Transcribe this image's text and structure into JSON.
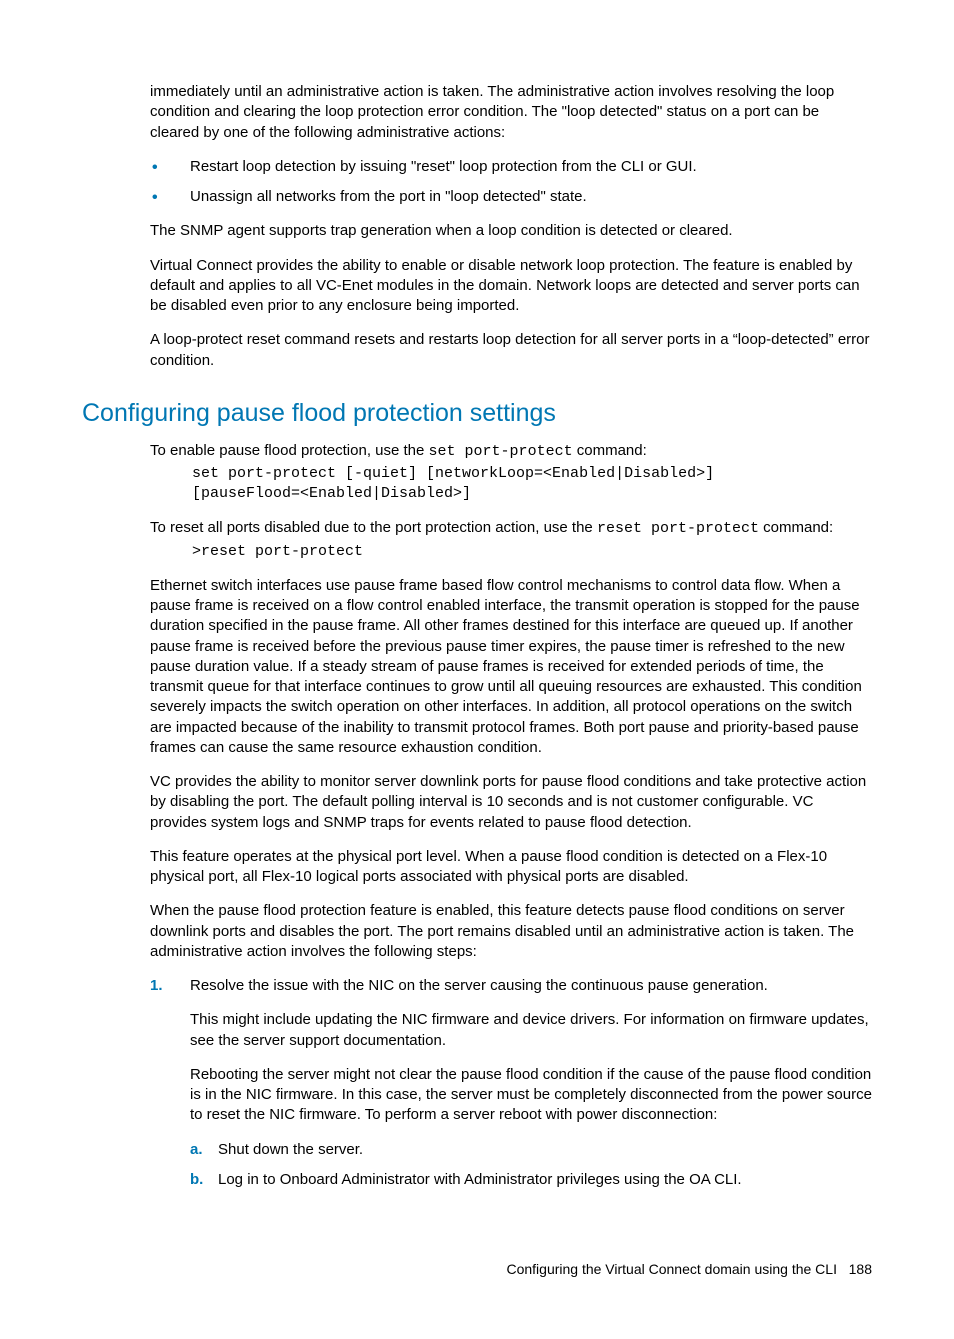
{
  "intro": {
    "p1": "immediately until an administrative action is taken. The administrative action involves resolving the loop condition and clearing the loop protection error condition. The \"loop detected\" status on a port can be cleared by one of the following administrative actions:",
    "bullets": [
      "Restart loop detection by issuing \"reset\" loop protection from the CLI or GUI.",
      "Unassign all networks from the port in \"loop detected\" state."
    ],
    "p2": "The SNMP agent supports trap generation when a loop condition is detected or cleared.",
    "p3": "Virtual Connect provides the ability to enable or disable network loop protection. The feature is enabled by default and applies to all VC-Enet modules in the domain. Network loops are detected and server ports can be disabled even prior to any enclosure being imported.",
    "p4": "A loop-protect reset command resets and restarts loop detection for all server ports in a “loop-detected” error condition."
  },
  "section": {
    "heading": "Configuring pause flood protection settings",
    "p1_a": "To enable pause flood protection, use the ",
    "p1_code": "set port-protect",
    "p1_b": " command:",
    "code1": "set port-protect [-quiet] [networkLoop=<Enabled|Disabled>]\n[pauseFlood=<Enabled|Disabled>]",
    "p2_a": "To reset all ports disabled due to the port protection action, use the ",
    "p2_code": "reset port-protect",
    "p2_b": " command:",
    "code2": ">reset port-protect",
    "p3": "Ethernet switch interfaces use pause frame based flow control mechanisms to control data flow. When a pause frame is received on a flow control enabled interface, the transmit operation is stopped for the pause duration specified in the pause frame. All other frames destined for this interface are queued up. If another pause frame is received before the previous pause timer expires, the pause timer is refreshed to the new pause duration value. If a steady stream of pause frames is received for extended periods of time, the transmit queue for that interface continues to grow until all queuing resources are exhausted. This condition severely impacts the switch operation on other interfaces. In addition, all protocol operations on the switch are impacted because of the inability to transmit protocol frames. Both port pause and priority-based pause frames can cause the same resource exhaustion condition.",
    "p4": "VC provides the ability to monitor server downlink ports for pause flood conditions and take protective action by disabling the port. The default polling interval is 10 seconds and is not customer configurable. VC provides system logs and SNMP traps for events related to pause flood detection.",
    "p5": "This feature operates at the physical port level. When a pause flood condition is detected on a Flex-10 physical port, all Flex-10 logical ports associated with physical ports are disabled.",
    "p6": "When the pause flood protection feature is enabled, this feature detects pause flood conditions on server downlink ports and disables the port. The port remains disabled until an administrative action is taken. The administrative action involves the following steps:",
    "step1": {
      "marker": "1.",
      "text": "Resolve the issue with the NIC on the server causing the continuous pause generation.",
      "p_a": "This might include updating the NIC firmware and device drivers. For information on firmware updates, see the server support documentation.",
      "p_b": "Rebooting the server might not clear the pause flood condition if the cause of the pause flood condition is in the NIC firmware. In this case, the server must be completely disconnected from the power source to reset the NIC firmware. To perform a server reboot with power disconnection:",
      "sub": [
        {
          "marker": "a.",
          "text": "Shut down the server."
        },
        {
          "marker": "b.",
          "text": "Log in to Onboard Administrator with Administrator privileges using the OA CLI."
        }
      ]
    }
  },
  "footer": {
    "text": "Configuring the Virtual Connect domain using the CLI",
    "page": "188"
  }
}
